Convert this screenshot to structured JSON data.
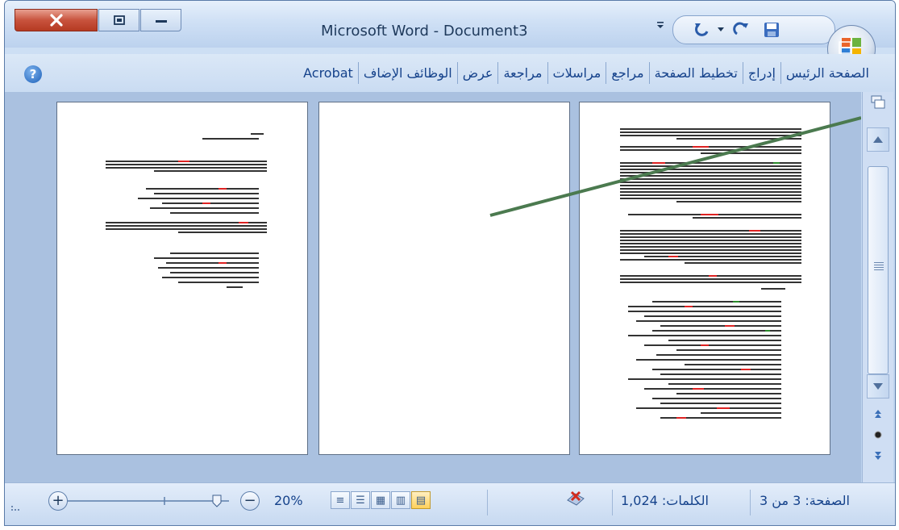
{
  "window": {
    "title": "Microsoft Word - Document3"
  },
  "ribbon": {
    "tabs": [
      "الصفحة الرئيس",
      "إدراج",
      "تخطيط الصفحة",
      "مراجع",
      "مراسلات",
      "مراجعة",
      "عرض",
      "الوظائف الإضاف",
      "Acrobat"
    ]
  },
  "status": {
    "page": "الصفحة: 3 من 3",
    "words": "الكلمات: 1,024",
    "zoom": "20%"
  },
  "icons": {
    "close": "close-icon",
    "restore": "restore-icon",
    "minimize": "minimize-icon",
    "undo": "undo-icon",
    "redo": "redo-icon",
    "save": "save-icon",
    "help": "help-icon",
    "office": "office-button-icon"
  },
  "colors": {
    "accent": "#15428b",
    "close": "#c8533d",
    "annotation_line": "#4b7a4f"
  }
}
